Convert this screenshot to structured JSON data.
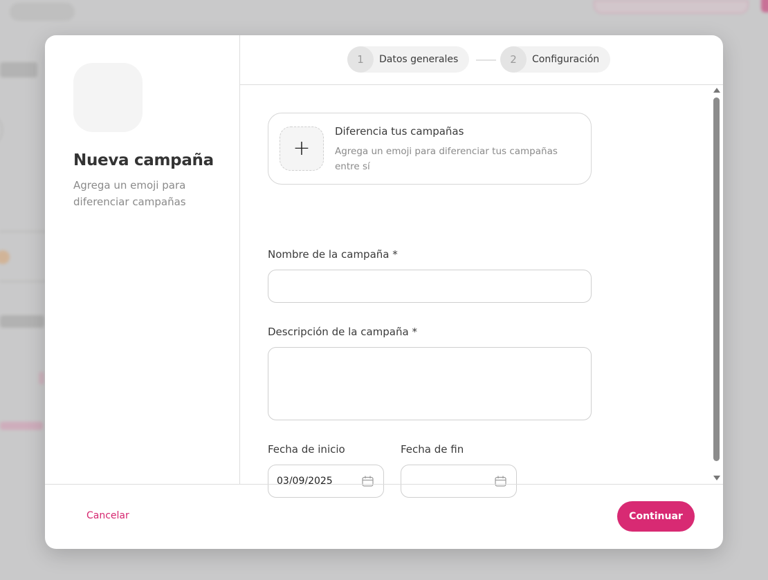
{
  "modal": {
    "left": {
      "title": "Nueva campaña",
      "subtitle": "Agrega un emoji para diferenciar campañas"
    },
    "stepper": {
      "steps": [
        {
          "number": "1",
          "label": "Datos generales"
        },
        {
          "number": "2",
          "label": "Configuración"
        }
      ]
    },
    "emoji_card": {
      "add_symbol": "+",
      "title": "Diferencia tus campañas",
      "description": "Agrega un emoji para diferenciar tus campañas entre sí"
    },
    "form": {
      "name_label": "Nombre de la campaña *",
      "name_value": "",
      "description_label": "Descripción de la campaña *",
      "description_value": "",
      "start_label": "Fecha de inicio",
      "start_value": "03/09/2025",
      "end_label": "Fecha de fin",
      "end_value": ""
    },
    "footer": {
      "cancel_label": "Cancelar",
      "continue_label": "Continuar"
    }
  },
  "colors": {
    "accent": "#d82a73",
    "accent_text": "#d6266f"
  },
  "icons": [
    "plus-icon",
    "calendar-icon",
    "scroll-up-arrow-icon",
    "scroll-down-arrow-icon"
  ]
}
